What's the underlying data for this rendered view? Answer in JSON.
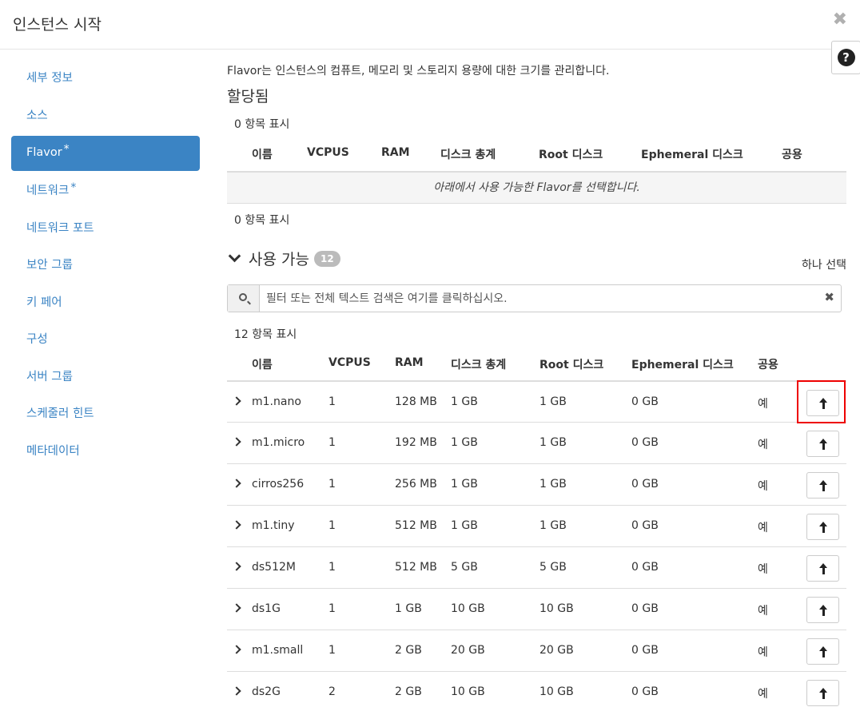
{
  "modal": {
    "title": "인스턴스 시작",
    "close_glyph": "✖",
    "help_glyph": "?"
  },
  "sidebar": {
    "items": [
      {
        "label": "세부 정보",
        "required": false,
        "active": false
      },
      {
        "label": "소스",
        "required": false,
        "active": false
      },
      {
        "label": "Flavor",
        "required": true,
        "active": true
      },
      {
        "label": "네트워크",
        "required": true,
        "active": false
      },
      {
        "label": "네트워크 포트",
        "required": false,
        "active": false
      },
      {
        "label": "보안 그룹",
        "required": false,
        "active": false
      },
      {
        "label": "키 페어",
        "required": false,
        "active": false
      },
      {
        "label": "구성",
        "required": false,
        "active": false
      },
      {
        "label": "서버 그룹",
        "required": false,
        "active": false
      },
      {
        "label": "스케줄러 힌트",
        "required": false,
        "active": false
      },
      {
        "label": "메타데이터",
        "required": false,
        "active": false
      }
    ],
    "required_mark": "*"
  },
  "main": {
    "help_text": "Flavor는 인스턴스의 컴퓨트, 메모리 및 스토리지 용량에 대한 크기를 관리합니다.",
    "allocated": {
      "title": "할당됨",
      "count_top": "0 항목 표시",
      "count_bottom": "0 항목 표시",
      "columns": [
        "이름",
        "VCPUS",
        "RAM",
        "디스크 총계",
        "Root 디스크",
        "Ephemeral 디스크",
        "공용"
      ],
      "empty_message": "아래에서 사용 가능한 Flavor를 선택합니다."
    },
    "available": {
      "title": "사용 가능",
      "badge": "12",
      "pick_label": "하나 선택",
      "search_placeholder": "필터 또는 전체 텍스트 검색은 여기를 클릭하십시오.",
      "clear_glyph": "✖",
      "count": "12 항목 표시",
      "columns": [
        "이름",
        "VCPUS",
        "RAM",
        "디스크 총계",
        "Root 디스크",
        "Ephemeral 디스크",
        "공용"
      ],
      "rows": [
        {
          "name": "m1.nano",
          "vcpus": "1",
          "ram": "128 MB",
          "disk_total": "1 GB",
          "root_disk": "1 GB",
          "ephemeral": "0 GB",
          "public": "예"
        },
        {
          "name": "m1.micro",
          "vcpus": "1",
          "ram": "192 MB",
          "disk_total": "1 GB",
          "root_disk": "1 GB",
          "ephemeral": "0 GB",
          "public": "예"
        },
        {
          "name": "cirros256",
          "vcpus": "1",
          "ram": "256 MB",
          "disk_total": "1 GB",
          "root_disk": "1 GB",
          "ephemeral": "0 GB",
          "public": "예"
        },
        {
          "name": "m1.tiny",
          "vcpus": "1",
          "ram": "512 MB",
          "disk_total": "1 GB",
          "root_disk": "1 GB",
          "ephemeral": "0 GB",
          "public": "예"
        },
        {
          "name": "ds512M",
          "vcpus": "1",
          "ram": "512 MB",
          "disk_total": "5 GB",
          "root_disk": "5 GB",
          "ephemeral": "0 GB",
          "public": "예"
        },
        {
          "name": "ds1G",
          "vcpus": "1",
          "ram": "1 GB",
          "disk_total": "10 GB",
          "root_disk": "10 GB",
          "ephemeral": "0 GB",
          "public": "예"
        },
        {
          "name": "m1.small",
          "vcpus": "1",
          "ram": "2 GB",
          "disk_total": "20 GB",
          "root_disk": "20 GB",
          "ephemeral": "0 GB",
          "public": "예"
        },
        {
          "name": "ds2G",
          "vcpus": "2",
          "ram": "2 GB",
          "disk_total": "10 GB",
          "root_disk": "10 GB",
          "ephemeral": "0 GB",
          "public": "예"
        }
      ]
    }
  },
  "colors": {
    "accent": "#3b84c4",
    "highlight": "#e00000"
  }
}
